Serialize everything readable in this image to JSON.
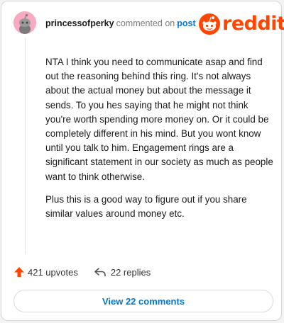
{
  "comment": {
    "username": "princessofperky",
    "action_text": "commented on",
    "post_link": "post",
    "paragraphs": [
      "NTA I think you need to communicate asap and find out the reasoning behind this ring. It's not always about the actual money but about the message it sends. To you hes saying that he might not think you're worth spending more money on. Or it could be completely different in his mind. But you wont know until you talk to him. Engagement rings are a significant statement in our society as much as people want to think otherwise.",
      "Plus this is a good way to figure out if you share similar values around money etc."
    ],
    "upvotes_label": "421 upvotes",
    "replies_label": "22 replies",
    "view_button_label": "View 22 comments"
  },
  "brand": {
    "logo_text": "reddit",
    "brand_color": "#ff4500",
    "link_color": "#0079d3",
    "avatar_color": "#f7aac2"
  },
  "icons": {
    "upvote": "upvote-arrow-icon",
    "reply": "reply-arrow-icon",
    "logo": "reddit-snoo-icon"
  }
}
